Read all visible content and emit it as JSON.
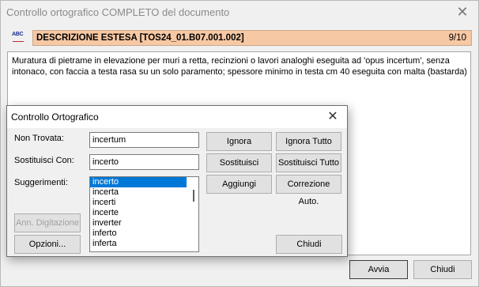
{
  "main_window": {
    "title": "Controllo ortografico COMPLETO del documento",
    "abc_icon": "ABC",
    "description_title": "DESCRIZIONE ESTESA [TOS24_01.B07.001.002]",
    "counter": "9/10",
    "text": "Muratura di pietrame in elevazione per muri a retta, recinzioni o lavori analoghi eseguita ad 'opus incertum', senza intonaco, con faccia a testa rasa su un solo paramento; spessore minimo in testa cm 40 eseguita con malta (bastarda)",
    "avvia_label": "Avvia",
    "chiudi_label": "Chiudi"
  },
  "dialog": {
    "title": "Controllo Ortografico",
    "not_found_label": "Non Trovata:",
    "not_found_value": "incertum",
    "replace_label": "Sostituisci Con:",
    "replace_value": "incerto",
    "suggestions_label": "Suggerimenti:",
    "suggestions": [
      "incerto",
      "incerta",
      "incerti",
      "incerte",
      "inverter",
      "inferto",
      "inferta"
    ],
    "selected_suggestion": 0,
    "buttons": {
      "ignora": "Ignora",
      "ignora_tutto": "Ignora Tutto",
      "sostituisci": "Sostituisci",
      "sostituisci_tutto": "Sostituisci Tutto",
      "aggiungi": "Aggiungi",
      "correzione_auto": "Correzione Auto.",
      "ann_digitazione": "Ann. Digitazione",
      "opzioni": "Opzioni...",
      "chiudi": "Chiudi"
    }
  },
  "colors": {
    "description_bar": "#f7c8a4",
    "selection": "#0078d7"
  }
}
